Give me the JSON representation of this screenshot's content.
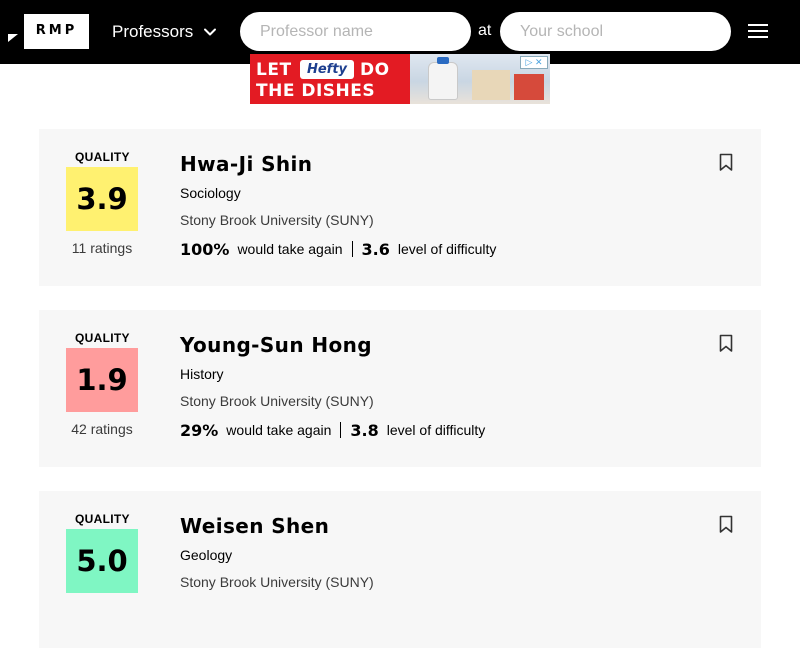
{
  "header": {
    "logo": "RMP",
    "nav_dropdown_label": "Professors",
    "professor_search_placeholder": "Professor name",
    "at_label": "at",
    "school_search_placeholder": "Your school"
  },
  "ad": {
    "line1_start": "LET",
    "brand": "Hefty",
    "line1_end": "DO",
    "line2": "THE DISHES",
    "choices_label": "▷ ✕"
  },
  "colors": {
    "header_bg": "#000000",
    "card_bg": "#f7f7f7",
    "quality_yellow": "#fff170",
    "quality_red": "#ff9c9c",
    "quality_green": "#7ff6c3"
  },
  "icons": [
    "chevron-down-icon",
    "hamburger-menu-icon",
    "bookmark-icon"
  ],
  "professors": [
    {
      "quality_label": "QUALITY",
      "score": "3.9",
      "ratings": "11 ratings",
      "name": "Hwa-Ji Shin",
      "department": "Sociology",
      "school": "Stony Brook University (SUNY)",
      "would_take_again": "100%",
      "would_take_again_label": "would take again",
      "difficulty": "3.6",
      "difficulty_label": "level of difficulty",
      "score_color": "yellow"
    },
    {
      "quality_label": "QUALITY",
      "score": "1.9",
      "ratings": "42 ratings",
      "name": "Young-Sun Hong",
      "department": "History",
      "school": "Stony Brook University (SUNY)",
      "would_take_again": "29%",
      "would_take_again_label": "would take again",
      "difficulty": "3.8",
      "difficulty_label": "level of difficulty",
      "score_color": "red"
    },
    {
      "quality_label": "QUALITY",
      "score": "5.0",
      "ratings": "",
      "name": "Weisen Shen",
      "department": "Geology",
      "school": "Stony Brook University (SUNY)",
      "would_take_again": "",
      "would_take_again_label": "",
      "difficulty": "",
      "difficulty_label": "",
      "score_color": "green"
    }
  ]
}
